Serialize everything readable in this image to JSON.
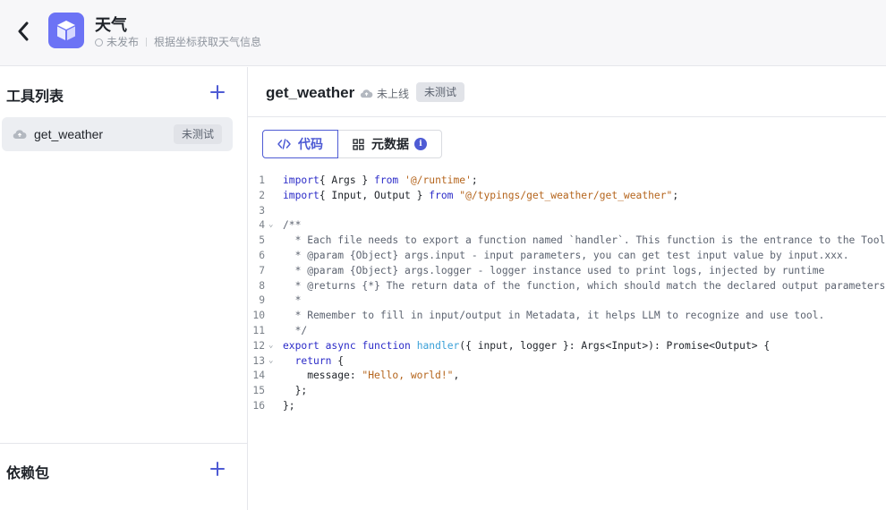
{
  "header": {
    "app_name": "天气",
    "status": "未发布",
    "description": "根据坐标获取天气信息"
  },
  "sidebar": {
    "tools_title": "工具列表",
    "tools": [
      {
        "name": "get_weather",
        "badge": "未测试"
      }
    ],
    "deps_title": "依赖包"
  },
  "main": {
    "function_name": "get_weather",
    "deploy_status": "未上线",
    "test_badge": "未测试",
    "tabs": [
      {
        "label": "代码",
        "active": true
      },
      {
        "label": "元数据",
        "active": false,
        "info": "i"
      }
    ]
  },
  "code_lines": [
    {
      "n": "1",
      "fold": ""
    },
    {
      "n": "2",
      "fold": ""
    },
    {
      "n": "3",
      "fold": ""
    },
    {
      "n": "4",
      "fold": "⌄"
    },
    {
      "n": "5",
      "fold": ""
    },
    {
      "n": "6",
      "fold": ""
    },
    {
      "n": "7",
      "fold": ""
    },
    {
      "n": "8",
      "fold": ""
    },
    {
      "n": "9",
      "fold": ""
    },
    {
      "n": "10",
      "fold": ""
    },
    {
      "n": "11",
      "fold": ""
    },
    {
      "n": "12",
      "fold": "⌄"
    },
    {
      "n": "13",
      "fold": "⌄"
    },
    {
      "n": "14",
      "fold": ""
    },
    {
      "n": "15",
      "fold": ""
    },
    {
      "n": "16",
      "fold": ""
    }
  ],
  "code_segments": [
    [
      [
        "kw",
        "import"
      ],
      [
        "",
        "{ Args } "
      ],
      [
        "kw",
        "from"
      ],
      [
        "",
        " "
      ],
      [
        "str",
        "'@/runtime'"
      ],
      [
        "",
        ";"
      ]
    ],
    [
      [
        "kw",
        "import"
      ],
      [
        "",
        "{ Input, Output } "
      ],
      [
        "kw",
        "from"
      ],
      [
        "",
        " "
      ],
      [
        "str",
        "\"@/typings/get_weather/get_weather\""
      ],
      [
        "",
        ";"
      ]
    ],
    [],
    [
      [
        "cm",
        "/**"
      ]
    ],
    [
      [
        "cm",
        "  * Each file needs to export a function named `handler`. This function is the entrance to the Tool."
      ]
    ],
    [
      [
        "cm",
        "  * @param {Object} args.input - input parameters, you can get test input value by input.xxx."
      ]
    ],
    [
      [
        "cm",
        "  * @param {Object} args.logger - logger instance used to print logs, injected by runtime"
      ]
    ],
    [
      [
        "cm",
        "  * @returns {*} The return data of the function, which should match the declared output parameters."
      ]
    ],
    [
      [
        "cm",
        "  *"
      ]
    ],
    [
      [
        "cm",
        "  * Remember to fill in input/output in Metadata, it helps LLM to recognize and use tool."
      ]
    ],
    [
      [
        "cm",
        "  */"
      ]
    ],
    [
      [
        "kw",
        "export"
      ],
      [
        "",
        " "
      ],
      [
        "kw",
        "async"
      ],
      [
        "",
        " "
      ],
      [
        "kw",
        "function"
      ],
      [
        "",
        " "
      ],
      [
        "fnc",
        "handler"
      ],
      [
        "",
        "({ input, logger }: Args<Input>): Promise<Output> {"
      ]
    ],
    [
      [
        "",
        "  "
      ],
      [
        "kw",
        "return"
      ],
      [
        "",
        " {"
      ]
    ],
    [
      [
        "",
        "    message: "
      ],
      [
        "str",
        "\"Hello, world!\""
      ],
      [
        "",
        ","
      ]
    ],
    [
      [
        "",
        "  };"
      ]
    ],
    [
      [
        "",
        "};"
      ]
    ]
  ],
  "colors": {
    "accent": "#4e5bd4",
    "logo": "#6c73f5",
    "keyword": "#2b2bc8",
    "string": "#b5651d",
    "function": "#3aa0d8",
    "comment": "#5c6370"
  },
  "icons": {
    "back": "chevron-left-icon",
    "logo": "cube-icon",
    "tool_status": "cloud-icon",
    "add": "plus-icon",
    "code_tab": "code-icon",
    "metadata_tab": "grid-icon"
  }
}
